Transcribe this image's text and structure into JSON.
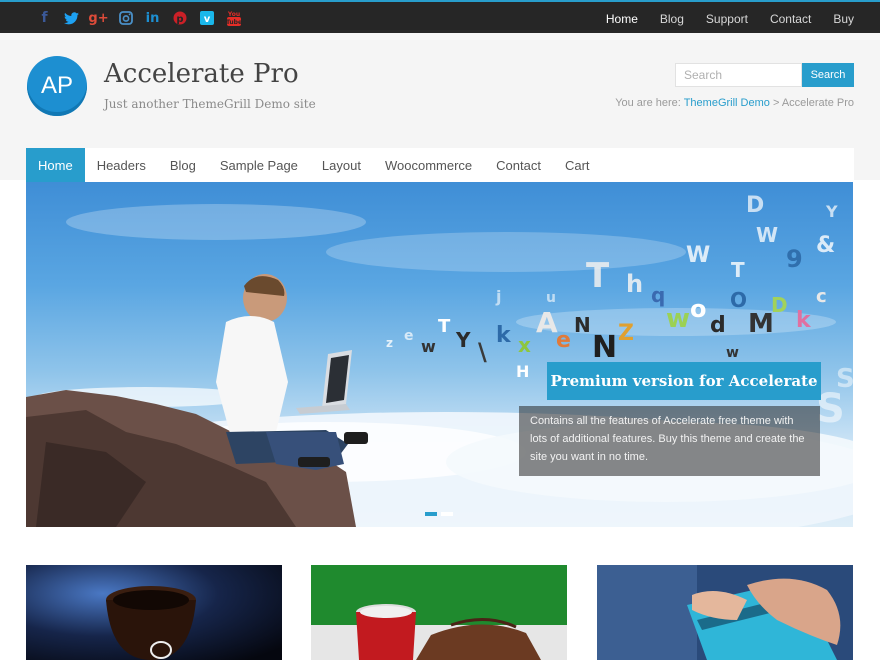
{
  "colors": {
    "accent": "#289dcc",
    "topbar": "#262626",
    "header_bg": "#f5f5f5"
  },
  "social": [
    {
      "icon": "facebook-icon",
      "glyph": "f",
      "color": "#3b5998"
    },
    {
      "icon": "twitter-icon",
      "glyph": "t",
      "color": "#1da1f2"
    },
    {
      "icon": "google-plus-icon",
      "glyph": "g+",
      "color": "#dd4b39"
    },
    {
      "icon": "instagram-icon",
      "glyph": "◘",
      "color": "#4a90c8"
    },
    {
      "icon": "linkedin-icon",
      "glyph": "in",
      "color": "#1d8fd1"
    },
    {
      "icon": "pinterest-icon",
      "glyph": "P",
      "color": "#cb2027"
    },
    {
      "icon": "vimeo-icon",
      "glyph": "V",
      "color": "#1ab7ea"
    },
    {
      "icon": "youtube-icon",
      "glyph": "▶",
      "color": "#e52d27"
    }
  ],
  "topnav": [
    "Home",
    "Blog",
    "Support",
    "Contact",
    "Buy"
  ],
  "header": {
    "logo_text": "AP",
    "site_title": "Accelerate Pro",
    "tagline": "Just another ThemeGrill Demo site",
    "search_placeholder": "Search",
    "search_button": "Search",
    "breadcrumb_prefix": "You are here:",
    "breadcrumb_link": "ThemeGrill Demo",
    "breadcrumb_sep": ">",
    "breadcrumb_current": "Accelerate Pro"
  },
  "nav": [
    "Home",
    "Headers",
    "Blog",
    "Sample Page",
    "Layout",
    "Woocommerce",
    "Contact",
    "Cart"
  ],
  "slider": {
    "caption_title": "Premium version for Accelerate",
    "caption_desc": "Contains all the features of Accelerate free theme with lots of additional features. Buy this theme and create the site you want in no time.",
    "active_slide": 1,
    "slide_count": 2
  }
}
